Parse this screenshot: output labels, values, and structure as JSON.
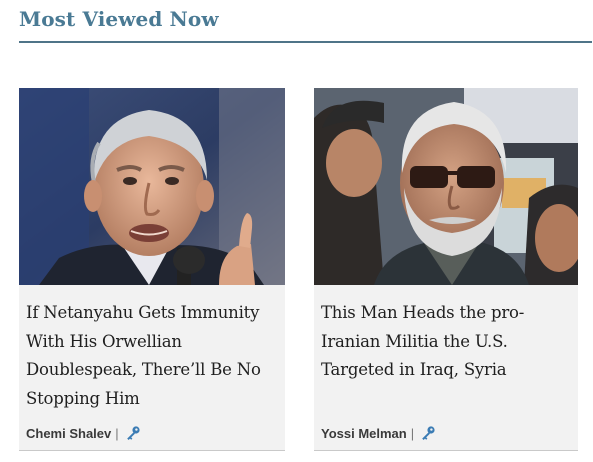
{
  "section": {
    "title": "Most Viewed Now"
  },
  "articles": [
    {
      "headline": "If Netanyahu Gets Immunity With His Orwellian Doublespeak, There’ll Be No Stopping Him",
      "author": "Chemi Shalev",
      "separator": "|",
      "icon": "key-icon"
    },
    {
      "headline": "This Man Heads the pro-Iranian Militia the U.S. Targeted in Iraq, Syria",
      "author": "Yossi Melman",
      "separator": "|",
      "icon": "key-icon"
    }
  ],
  "colors": {
    "title": "#4a7a94",
    "rule": "#4f7488",
    "card_bg": "#f2f2f2",
    "key_icon": "#3b7cb4"
  }
}
